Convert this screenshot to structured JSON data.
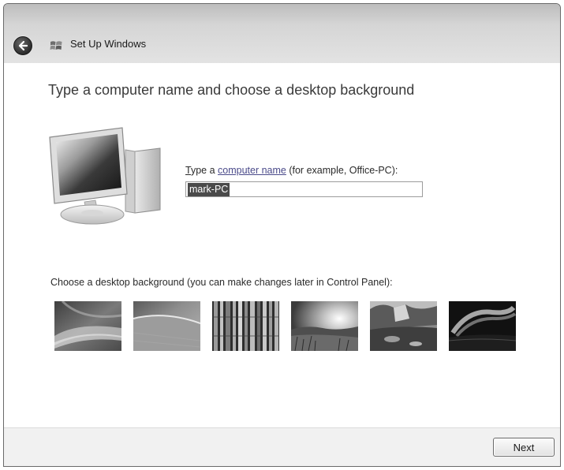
{
  "window": {
    "title": "Set Up Windows"
  },
  "page": {
    "heading": "Type a computer name and choose a desktop background"
  },
  "computer_name": {
    "label_prefix_underlined": "T",
    "label_text": "ype a ",
    "label_link": "computer name",
    "label_suffix": " (for example, Office-PC):",
    "value": "mark-PC"
  },
  "background": {
    "label": "Choose a desktop background (you can make changes later in Control Panel):",
    "thumbnails": [
      {
        "name": "aurora-swirl"
      },
      {
        "name": "green-curve"
      },
      {
        "name": "bamboo"
      },
      {
        "name": "sunset-meadow"
      },
      {
        "name": "rocky-lake"
      },
      {
        "name": "aurora-night"
      }
    ]
  },
  "footer": {
    "next_label": "Next"
  },
  "icons": {
    "back": "back-arrow-icon",
    "setup": "windows-setup-icon",
    "computer": "computer-icon"
  }
}
